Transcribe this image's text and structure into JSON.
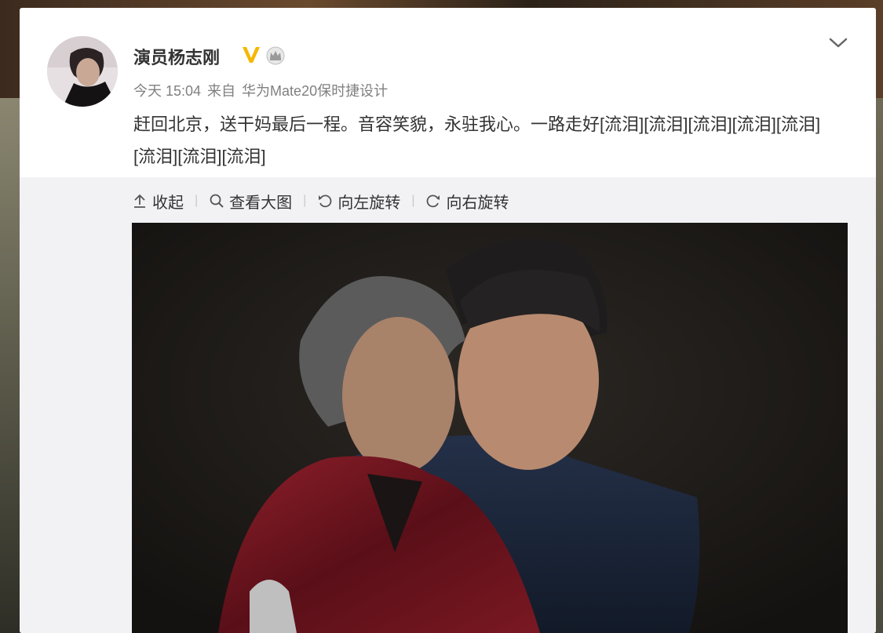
{
  "post": {
    "author": "演员杨志刚",
    "badge": "V",
    "time": "今天 15:04",
    "source_prefix": "来自",
    "source": "华为Mate20保时捷设计",
    "text": "赶回北京，送干妈最后一程。音容笑貌，永驻我心。一路走好[流泪][流泪][流泪][流泪][流泪][流泪][流泪][流泪]"
  },
  "toolbar": {
    "collapse": "收起",
    "view_large": "查看大图",
    "rotate_left": "向左旋转",
    "rotate_right": "向右旋转",
    "separator": "|"
  },
  "icons": {
    "verified": "v-badge-icon",
    "member": "crown-icon",
    "more": "chevron-down-icon",
    "collapse": "arrow-up-icon",
    "zoom": "search-icon",
    "rotate_left": "rotate-left-icon",
    "rotate_right": "rotate-right-icon"
  },
  "colors": {
    "verified": "#f5b700",
    "text": "#333333",
    "meta": "#808080",
    "media_bg": "#f2f2f5"
  }
}
